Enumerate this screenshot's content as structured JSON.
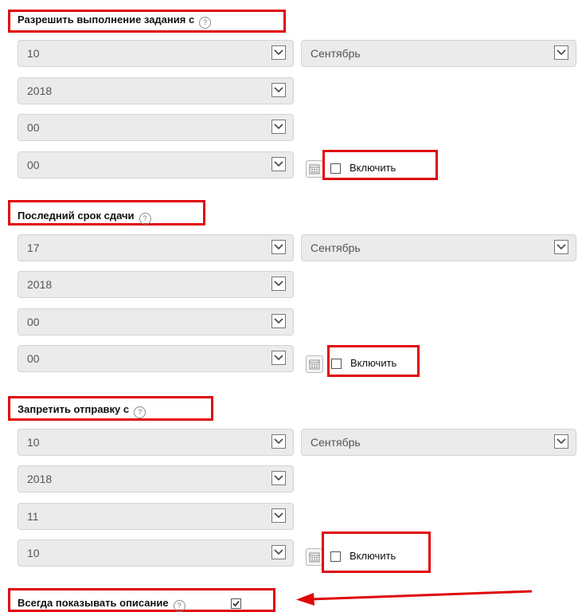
{
  "help_glyph": "?",
  "sections": [
    {
      "heading": "Разрешить выполнение задания с",
      "day": "10",
      "month": "Сентябрь",
      "year": "2018",
      "hour": "00",
      "minute": "00",
      "enable_label": "Включить",
      "enabled": false
    },
    {
      "heading": "Последний срок сдачи",
      "day": "17",
      "month": "Сентябрь",
      "year": "2018",
      "hour": "00",
      "minute": "00",
      "enable_label": "Включить",
      "enabled": false
    },
    {
      "heading": "Запретить отправку с",
      "day": "10",
      "month": "Сентябрь",
      "year": "2018",
      "hour": "11",
      "minute": "10",
      "enable_label": "Включить",
      "enabled": false
    }
  ],
  "always_show": {
    "label": "Всегда показывать описание",
    "checked": true
  },
  "colors": {
    "annotation_red": "#e0070b",
    "select_bg": "#ebebeb"
  }
}
